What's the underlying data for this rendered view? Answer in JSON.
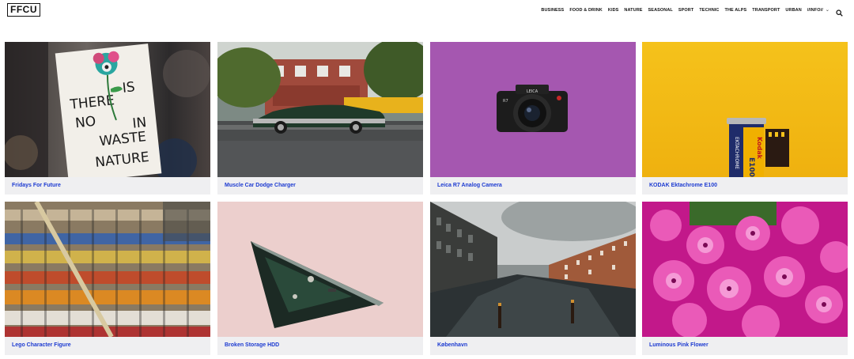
{
  "header": {
    "logo": "FFCU",
    "nav": [
      "BUSINESS",
      "FOOD & DRINK",
      "KIDS",
      "NATURE",
      "SEASONAL",
      "SPORT",
      "TECHNIC",
      "THE ALPS",
      "TRANSPORT",
      "URBAN"
    ],
    "info_label": "//INFO//",
    "search_icon": "search-icon"
  },
  "colors": {
    "caption_link": "#1d3bd1",
    "card_bg": "#efeff1"
  },
  "cards": [
    {
      "title": "Fridays For Future",
      "sign_text": [
        "THERE",
        "IS",
        "NO",
        "WASTE",
        "IN",
        "NATURE"
      ]
    },
    {
      "title": "Muscle Car Dodge Charger"
    },
    {
      "title": "Leica R7 Analog Camera",
      "camera_brand": "LEICA",
      "camera_model": "R7"
    },
    {
      "title": "KODAK Ektachrome E100",
      "film_brand": "Kodak",
      "film_name": "EKTACHROME",
      "film_code": "E100"
    },
    {
      "title": "Lego Character Figure"
    },
    {
      "title": "Broken Storage HDD"
    },
    {
      "title": "København"
    },
    {
      "title": "Luminous Pink Flower"
    }
  ]
}
